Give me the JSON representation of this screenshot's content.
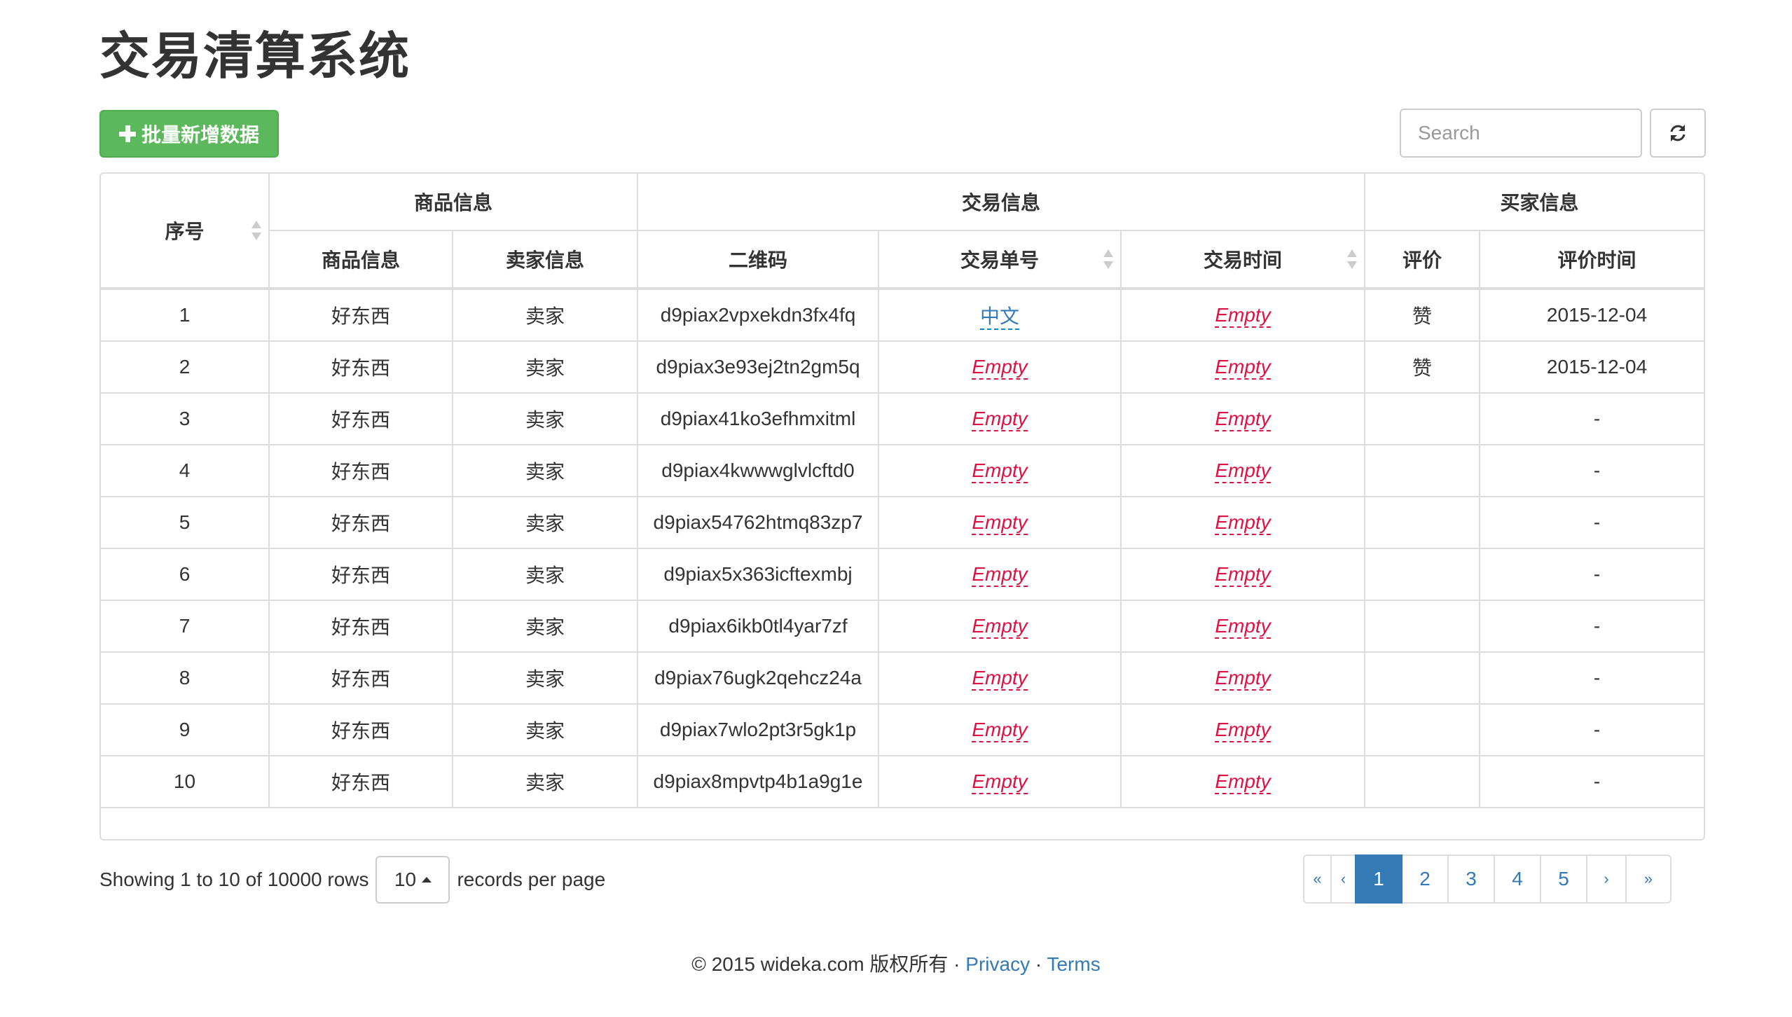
{
  "page_title": "交易清算系统",
  "toolbar": {
    "add_button_label": "批量新增数据",
    "search_placeholder": "Search",
    "refresh_icon": "refresh-icon"
  },
  "table": {
    "group_headers": {
      "index": "序号",
      "product_group": "商品信息",
      "trade_group": "交易信息",
      "buyer_group": "买家信息"
    },
    "column_headers": {
      "product_info": "商品信息",
      "seller_info": "卖家信息",
      "qr_code": "二维码",
      "trade_no": "交易单号",
      "trade_time": "交易时间",
      "rating": "评价",
      "rating_time": "评价时间"
    },
    "rows": [
      {
        "index": "1",
        "product": "好东西",
        "seller": "卖家",
        "qr": "d9piax2vpxekdn3fx4fq",
        "trade_no": "中文",
        "trade_time": "Empty",
        "rating": "赞",
        "rating_time": "2015-12-04"
      },
      {
        "index": "2",
        "product": "好东西",
        "seller": "卖家",
        "qr": "d9piax3e93ej2tn2gm5q",
        "trade_no": "Empty",
        "trade_time": "Empty",
        "rating": "赞",
        "rating_time": "2015-12-04"
      },
      {
        "index": "3",
        "product": "好东西",
        "seller": "卖家",
        "qr": "d9piax41ko3efhmxitml",
        "trade_no": "Empty",
        "trade_time": "Empty",
        "rating": "",
        "rating_time": "-"
      },
      {
        "index": "4",
        "product": "好东西",
        "seller": "卖家",
        "qr": "d9piax4kwwwglvlcftd0",
        "trade_no": "Empty",
        "trade_time": "Empty",
        "rating": "",
        "rating_time": "-"
      },
      {
        "index": "5",
        "product": "好东西",
        "seller": "卖家",
        "qr": "d9piax54762htmq83zp7",
        "trade_no": "Empty",
        "trade_time": "Empty",
        "rating": "",
        "rating_time": "-"
      },
      {
        "index": "6",
        "product": "好东西",
        "seller": "卖家",
        "qr": "d9piax5x363icftexmbj",
        "trade_no": "Empty",
        "trade_time": "Empty",
        "rating": "",
        "rating_time": "-"
      },
      {
        "index": "7",
        "product": "好东西",
        "seller": "卖家",
        "qr": "d9piax6ikb0tl4yar7zf",
        "trade_no": "Empty",
        "trade_time": "Empty",
        "rating": "",
        "rating_time": "-"
      },
      {
        "index": "8",
        "product": "好东西",
        "seller": "卖家",
        "qr": "d9piax76ugk2qehcz24a",
        "trade_no": "Empty",
        "trade_time": "Empty",
        "rating": "",
        "rating_time": "-"
      },
      {
        "index": "9",
        "product": "好东西",
        "seller": "卖家",
        "qr": "d9piax7wlo2pt3r5gk1p",
        "trade_no": "Empty",
        "trade_time": "Empty",
        "rating": "",
        "rating_time": "-"
      },
      {
        "index": "10",
        "product": "好东西",
        "seller": "卖家",
        "qr": "d9piax8mpvtp4b1a9g1e",
        "trade_no": "Empty",
        "trade_time": "Empty",
        "rating": "",
        "rating_time": "-"
      }
    ]
  },
  "pagination": {
    "showing_text": "Showing 1 to 10 of 10000 rows",
    "page_size": "10",
    "per_page_text": "records per page",
    "first": "«",
    "prev": "‹",
    "pages": [
      "1",
      "2",
      "3",
      "4",
      "5"
    ],
    "active_page": "1",
    "next": "›",
    "last": "»"
  },
  "footer": {
    "copyright": "© 2015 wideka.com",
    "rights": "版权所有",
    "separator": "·",
    "privacy": "Privacy",
    "terms": "Terms"
  },
  "colors": {
    "success": "#5cb85c",
    "primary": "#337ab7",
    "empty_text": "#dd1144",
    "border": "#dddddd"
  }
}
